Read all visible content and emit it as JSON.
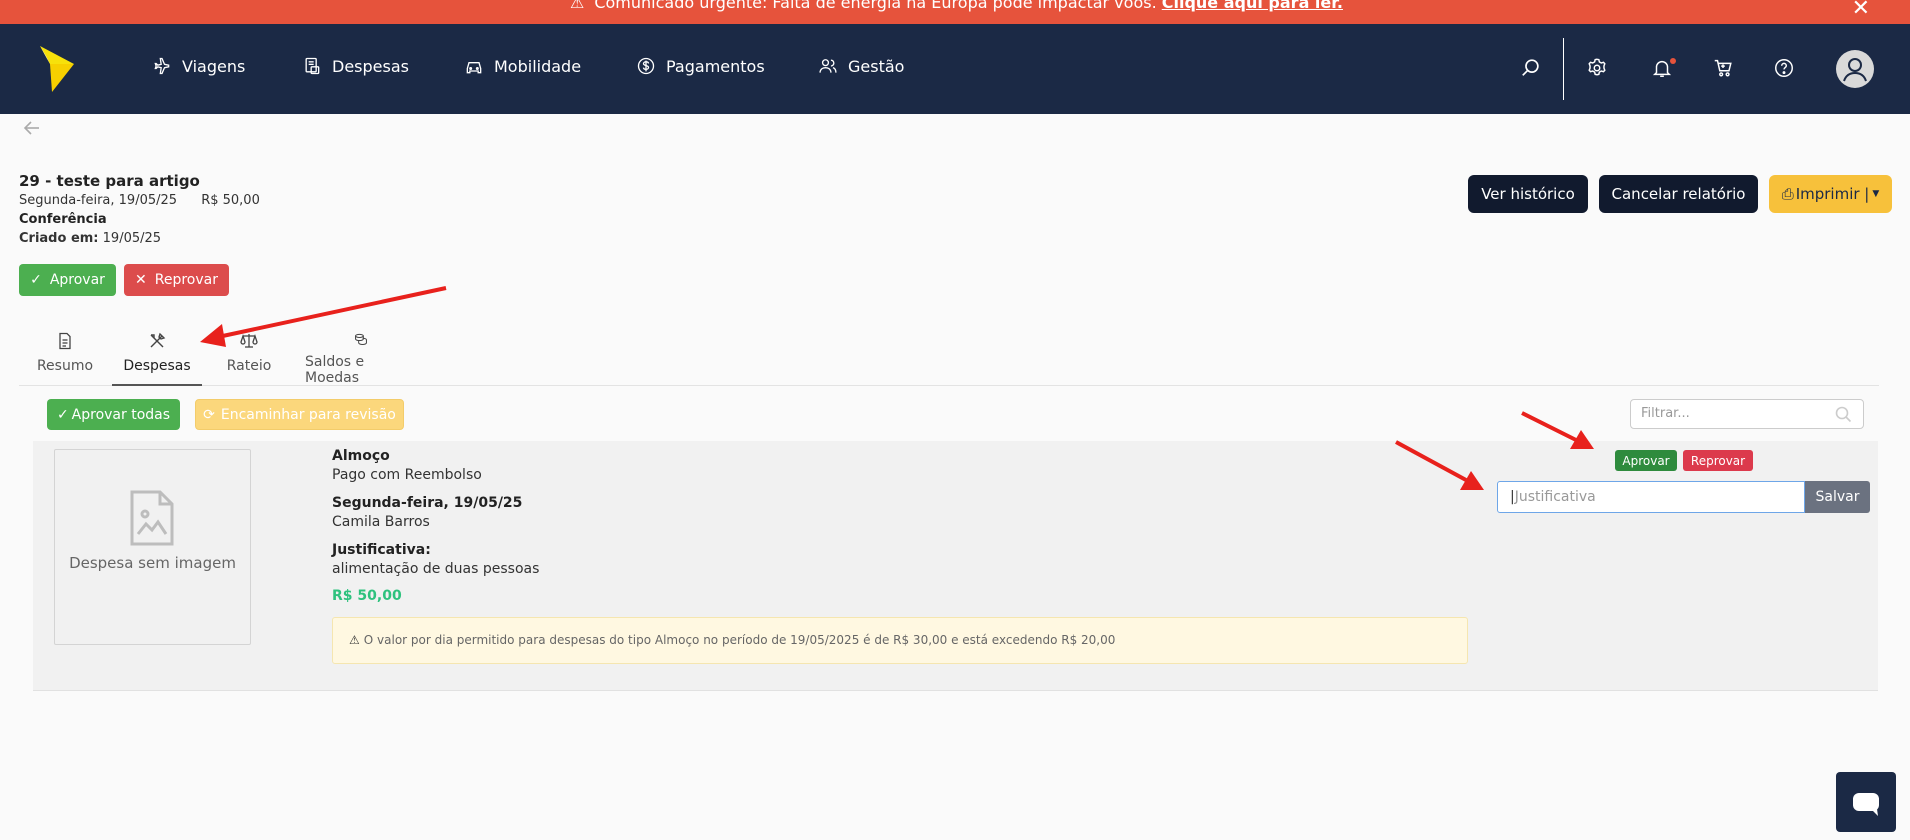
{
  "alert": {
    "message": "Comunicado urgente: Falta de energia na Europa pode impactar voos.",
    "link": "Clique aqui para ler."
  },
  "nav": {
    "items": [
      {
        "label": "Viagens",
        "icon": "airplane-icon"
      },
      {
        "label": "Despesas",
        "icon": "receipt-icon"
      },
      {
        "label": "Mobilidade",
        "icon": "car-icon"
      },
      {
        "label": "Pagamentos",
        "icon": "dollar-circle-icon"
      },
      {
        "label": "Gestão",
        "icon": "users-icon"
      }
    ],
    "right_icons": [
      "search-icon",
      "gear-icon",
      "bell-icon",
      "cart-icon",
      "help-icon",
      "avatar"
    ]
  },
  "report": {
    "title": "29 - teste para artigo",
    "date": "Segunda-feira, 19/05/25",
    "amount": "R$ 50,00",
    "status": "Conferência",
    "created_label": "Criado em:",
    "created_value": "19/05/25"
  },
  "header_buttons": {
    "history": "Ver histórico",
    "cancel": "Cancelar relatório",
    "print": "Imprimir |"
  },
  "actions": {
    "approve": "Aprovar",
    "reject": "Reprovar"
  },
  "tabs": [
    {
      "label": "Resumo",
      "icon": "document-icon"
    },
    {
      "label": "Despesas",
      "icon": "utensils-icon",
      "active": true
    },
    {
      "label": "Rateio",
      "icon": "scale-icon"
    },
    {
      "label": "Saldos e Moedas",
      "icon": "coins-icon"
    }
  ],
  "list_actions": {
    "approve_all": "Aprovar todas",
    "forward": "Encaminhar para revisão",
    "filter_placeholder": "Filtrar..."
  },
  "expense": {
    "image_caption": "Despesa sem imagem",
    "category": "Almoço",
    "payment": "Pago com Reembolso",
    "date": "Segunda-feira, 19/05/25",
    "user": "Camila Barros",
    "justification_label": "Justificativa:",
    "justification": "alimentação de duas pessoas",
    "amount": "R$ 50,00",
    "warning": "O valor por dia permitido para despesas do tipo Almoço no período de 19/05/2025 é de R$ 30,00 e está excedendo R$ 20,00",
    "approve": "Aprovar",
    "reject": "Reprovar",
    "justification_placeholder": "Justificativa",
    "save": "Salvar"
  },
  "colors": {
    "nav_bg": "#1b2945",
    "alert_bg": "#e6533c",
    "accent_yellow": "#f7c13b",
    "green": "#4caf50",
    "red": "#dc4c4c",
    "annotation_arrow": "#e8211c"
  }
}
